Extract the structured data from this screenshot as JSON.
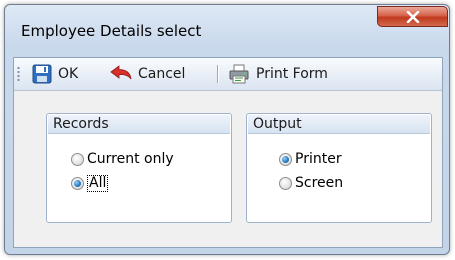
{
  "window": {
    "title": "Employee Details select",
    "close_icon": "close-x-icon"
  },
  "toolbar": {
    "ok_label": "OK",
    "ok_icon": "floppy-disk-icon",
    "cancel_label": "Cancel",
    "cancel_icon": "undo-arrow-icon",
    "print_label": "Print Form",
    "print_icon": "printer-icon"
  },
  "records": {
    "header": "Records",
    "options": [
      {
        "label": "Current only",
        "checked": false
      },
      {
        "label": "All",
        "checked": true,
        "focused": true
      }
    ]
  },
  "output": {
    "header": "Output",
    "options": [
      {
        "label": "Printer",
        "checked": true
      },
      {
        "label": "Screen",
        "checked": false
      }
    ]
  },
  "colors": {
    "close_button": "#c8452d",
    "group_border": "#9fb4cc",
    "toolbar_bg": "#e6edf6",
    "radio_selected": "#2a7ec8"
  }
}
